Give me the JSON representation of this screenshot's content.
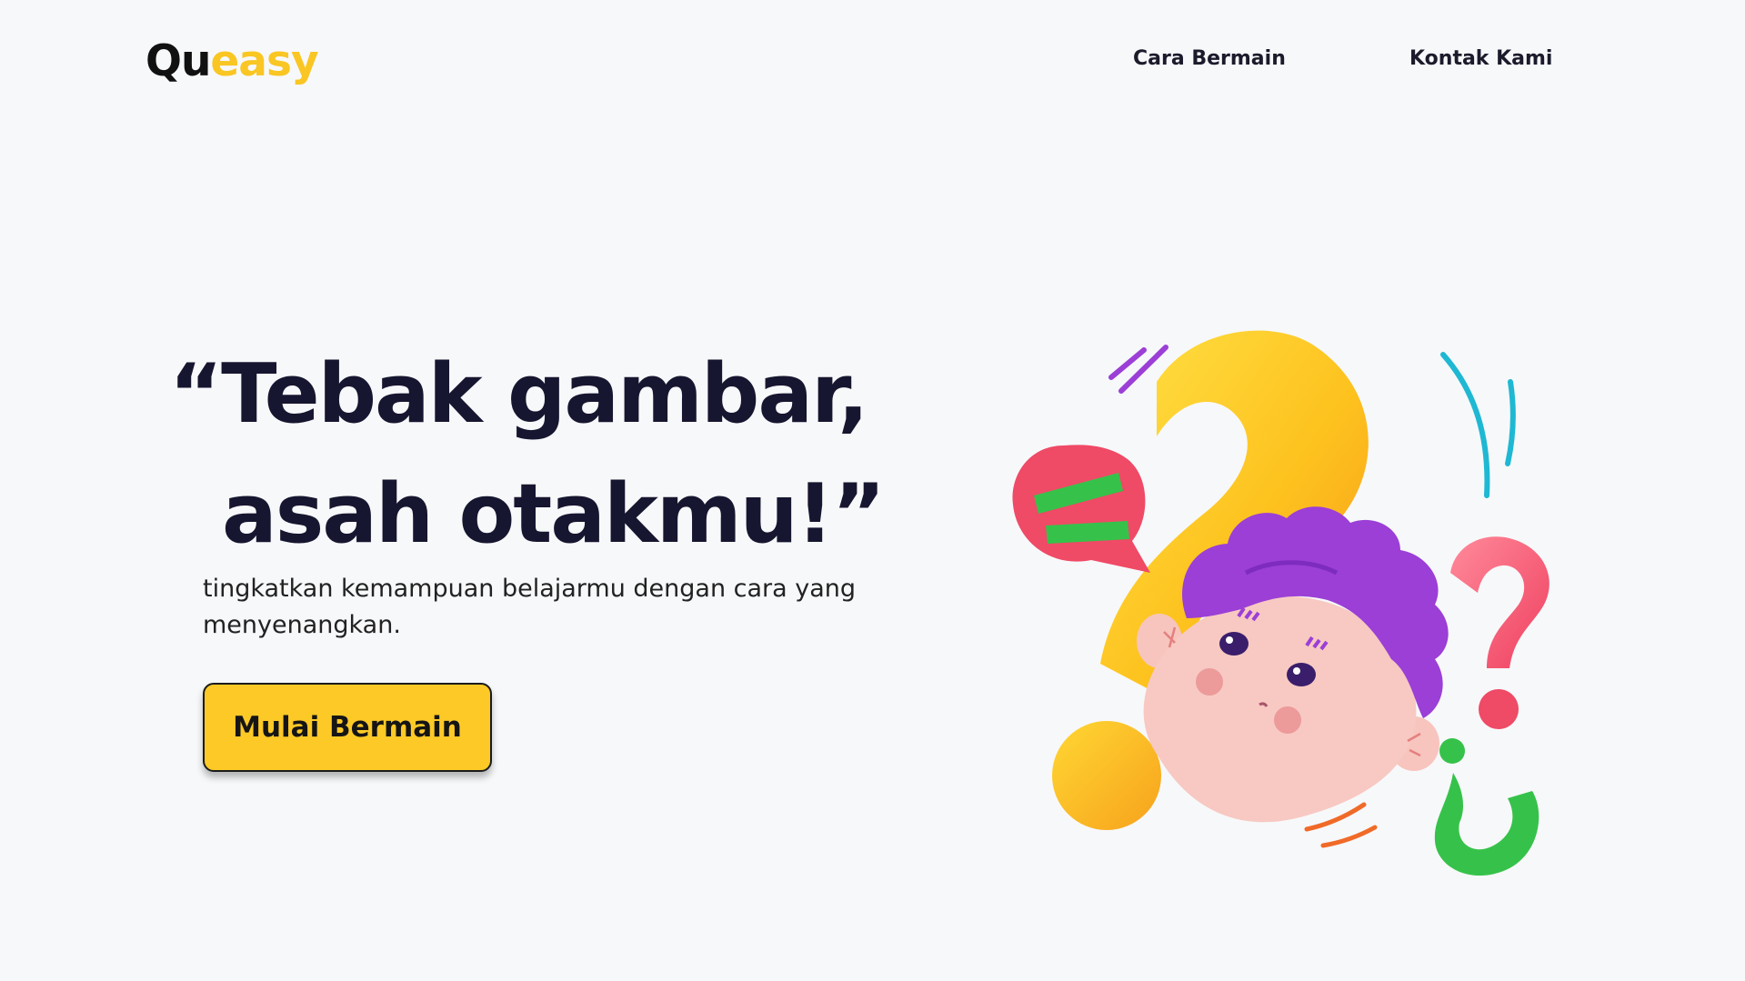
{
  "brand": {
    "part1": "Qu",
    "part2": "easy"
  },
  "nav": {
    "cara": "Cara Bermain",
    "kontak": "Kontak Kami"
  },
  "hero": {
    "line1": "“Tebak gambar,",
    "line2": "asah otakmu!”",
    "subtitle": "tingkatkan kemampuan belajarmu dengan cara yang menyenangkan.",
    "cta": "Mulai Bermain"
  },
  "colors": {
    "background": "#f7f8fa",
    "accent": "#fcc927",
    "text": "#171630",
    "hair": "#9b3fd6",
    "bubble": "#ef4a66",
    "check": "#36c24a"
  },
  "illustration": {
    "icons": [
      "question-mark-icon",
      "speech-bubble-icon",
      "inverted-question-mark-icon",
      "boy-face-icon"
    ]
  }
}
